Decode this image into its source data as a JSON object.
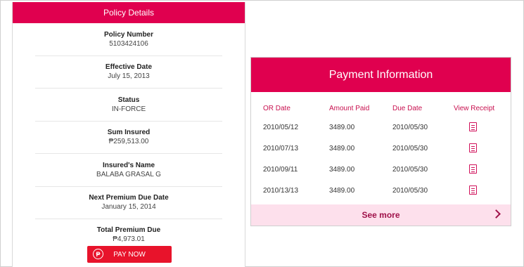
{
  "policy": {
    "title": "Policy Details",
    "fields": [
      {
        "label": "Policy Number",
        "value": "5103424106"
      },
      {
        "label": "Effective Date",
        "value": "July 15, 2013"
      },
      {
        "label": "Status",
        "value": "IN-FORCE"
      },
      {
        "label": "Sum Insured",
        "value": "₱259,513.00"
      },
      {
        "label": "Insured's Name",
        "value": "BALABA GRASAL G"
      },
      {
        "label": "Next Premium Due Date",
        "value": "January 15, 2014"
      },
      {
        "label": "Total Premium Due",
        "value": "₱4,973.01"
      }
    ],
    "pay_button": {
      "label": "PAY NOW",
      "icon": "peso-icon"
    }
  },
  "payment": {
    "title": "Payment Information",
    "columns": [
      "OR Date",
      "Amount Paid",
      "Due Date",
      "View Receipt"
    ],
    "rows": [
      {
        "or_date": "2010/05/12",
        "amount": "3489.00",
        "due_date": "2010/05/30",
        "receipt_icon": "receipt-icon"
      },
      {
        "or_date": "2010/07/13",
        "amount": "3489.00",
        "due_date": "2010/05/30",
        "receipt_icon": "receipt-icon"
      },
      {
        "or_date": "2010/09/11",
        "amount": "3489.00",
        "due_date": "2010/05/30",
        "receipt_icon": "receipt-icon"
      },
      {
        "or_date": "2010/13/13",
        "amount": "3489.00",
        "due_date": "2010/05/30",
        "receipt_icon": "receipt-icon"
      }
    ],
    "see_more": "See more"
  },
  "colors": {
    "brand": "#e0004f",
    "pay_button": "#e8132b",
    "see_more_bg": "#fde0ec"
  }
}
